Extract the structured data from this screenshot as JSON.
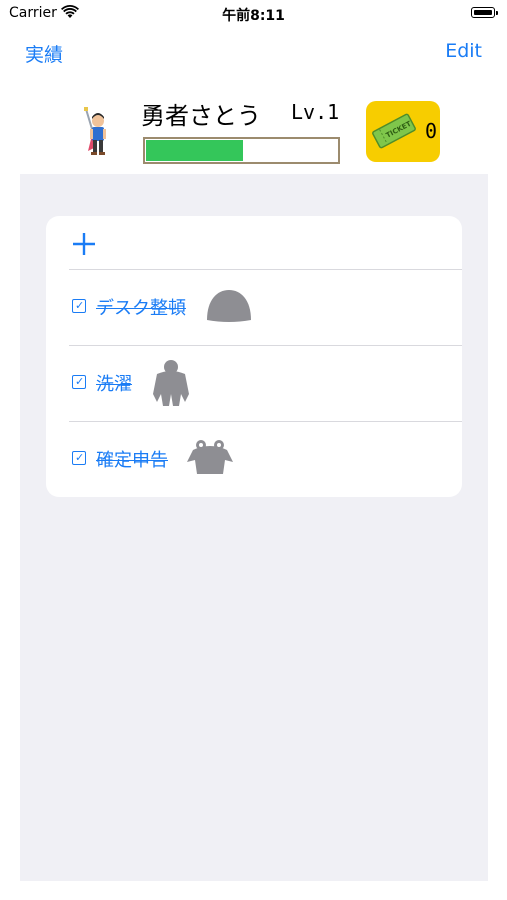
{
  "status_bar": {
    "carrier": "Carrier",
    "time": "午前8:11"
  },
  "nav": {
    "left_label": "実績",
    "right_label": "Edit"
  },
  "hero": {
    "name": "勇者さとう",
    "level": "Lv.1",
    "hp_fraction": 0.5
  },
  "ticket": {
    "count": "0",
    "icon": "ticket-icon"
  },
  "tasks": [
    {
      "label": "デスク整頓",
      "checked": true,
      "monster": "slime-silhouette-icon"
    },
    {
      "label": "洗濯",
      "checked": true,
      "monster": "gorilla-silhouette-icon"
    },
    {
      "label": "確定申告",
      "checked": true,
      "monster": "frog-silhouette-icon"
    }
  ],
  "colors": {
    "accent": "#1a7cf5",
    "hp": "#34c65a",
    "ticket_bg": "#f7cd00",
    "background": "#f0f0f5",
    "monster": "#8e8e93"
  }
}
